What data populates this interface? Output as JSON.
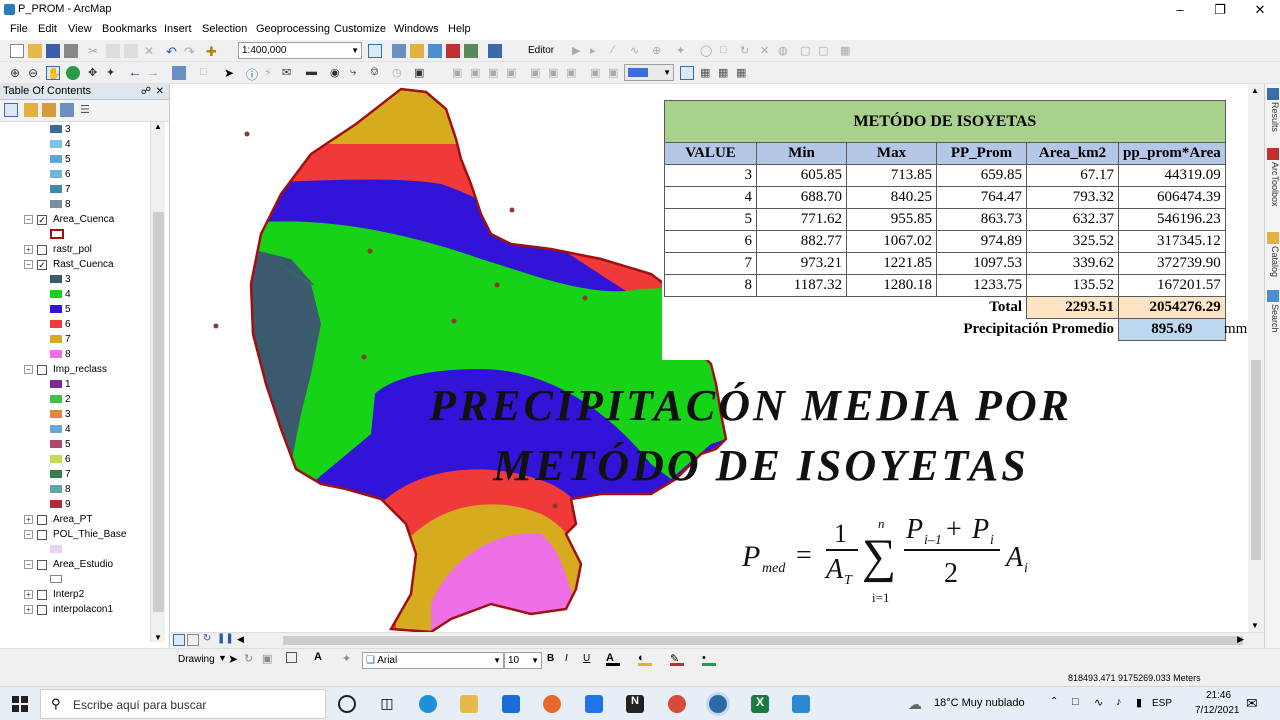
{
  "window": {
    "title": "P_PROM - ArcMap"
  },
  "menu": [
    "File",
    "Edit",
    "View",
    "Bookmarks",
    "Insert",
    "Selection",
    "Geoprocessing",
    "Customize",
    "Windows",
    "Help"
  ],
  "toolbar": {
    "scale_value": "1:400,000",
    "editor_label": "Editor"
  },
  "toc": {
    "title": "Table Of Contents",
    "rows": [
      {
        "type": "swatch",
        "label": "3",
        "color": "#3a6e9a"
      },
      {
        "type": "swatch",
        "label": "4",
        "color": "#7ec3e6"
      },
      {
        "type": "swatch",
        "label": "5",
        "color": "#5aa7d8"
      },
      {
        "type": "swatch",
        "label": "6",
        "color": "#6fb6d9"
      },
      {
        "type": "swatch",
        "label": "7",
        "color": "#3f8aa8"
      },
      {
        "type": "swatch",
        "label": "8",
        "color": "#7a8f9e"
      },
      {
        "type": "layer",
        "label": "Area_Cuenca",
        "checked": "✓"
      },
      {
        "type": "outline",
        "label": "",
        "color": "#a01010"
      },
      {
        "type": "layer",
        "label": "rastr_pol",
        "checked": ""
      },
      {
        "type": "layer",
        "label": "Rast_Cuenca",
        "checked": "✓"
      },
      {
        "type": "swatch",
        "label": "3",
        "color": "#3c5a6e"
      },
      {
        "type": "swatch",
        "label": "4",
        "color": "#17d317"
      },
      {
        "type": "swatch",
        "label": "5",
        "color": "#3214d8"
      },
      {
        "type": "swatch",
        "label": "6",
        "color": "#f03a3a"
      },
      {
        "type": "swatch",
        "label": "7",
        "color": "#d6ab1e"
      },
      {
        "type": "swatch",
        "label": "8",
        "color": "#ef70e6"
      },
      {
        "type": "layer",
        "label": "Imp_reclass",
        "checked": ""
      },
      {
        "type": "swatch",
        "label": "1",
        "color": "#7a2c8a"
      },
      {
        "type": "swatch",
        "label": "2",
        "color": "#44c04a"
      },
      {
        "type": "swatch",
        "label": "3",
        "color": "#e0893a"
      },
      {
        "type": "swatch",
        "label": "4",
        "color": "#6aa3d8"
      },
      {
        "type": "swatch",
        "label": "5",
        "color": "#b04a6a"
      },
      {
        "type": "swatch",
        "label": "6",
        "color": "#c8d850"
      },
      {
        "type": "swatch",
        "label": "7",
        "color": "#3a7a4a"
      },
      {
        "type": "swatch",
        "label": "8",
        "color": "#5aaaa0"
      },
      {
        "type": "swatch",
        "label": "9",
        "color": "#b02a3a"
      },
      {
        "type": "layer",
        "label": "Area_PT",
        "checked": ""
      },
      {
        "type": "layer",
        "label": "POL_Thie_Base",
        "checked": ""
      },
      {
        "type": "swatch",
        "label": "",
        "color": "#e8d4f0"
      },
      {
        "type": "layer",
        "label": "Area_Estudio",
        "checked": ""
      },
      {
        "type": "swatch",
        "label": "",
        "color": "#ffffff"
      },
      {
        "type": "layer",
        "label": "Interp2",
        "checked": ""
      },
      {
        "type": "layer",
        "label": "interpolacon1",
        "checked": ""
      }
    ]
  },
  "table": {
    "title": "METÓDO DE ISOYETAS",
    "headers": [
      "VALUE",
      "Min",
      "Max",
      "PP_Prom",
      "Area_km2",
      "pp_prom*Area"
    ],
    "rows": [
      [
        "3",
        "605.85",
        "713.85",
        "659.85",
        "67.17",
        "44319.09"
      ],
      [
        "4",
        "688.70",
        "840.25",
        "764.47",
        "793.32",
        "606474.39"
      ],
      [
        "5",
        "771.62",
        "955.85",
        "863.73",
        "632.37",
        "546196.23"
      ],
      [
        "6",
        "882.77",
        "1067.02",
        "974.89",
        "325.52",
        "317345.12"
      ],
      [
        "7",
        "973.21",
        "1221.85",
        "1097.53",
        "339.62",
        "372739.90"
      ],
      [
        "8",
        "1187.32",
        "1280.18",
        "1233.75",
        "135.52",
        "167201.57"
      ]
    ],
    "total_label": "Total",
    "total_area": "2293.51",
    "total_product": "2054276.29",
    "promedio_label": "Precipitación Promedio",
    "promedio_value": "895.69",
    "unit": "mm"
  },
  "overlay": {
    "line1": "PRECIPITACÓN MEDIA POR",
    "line2": "METÓDO DE ISOYETAS"
  },
  "right_tabs": [
    "Results",
    "ArcToolbox",
    "Catalog",
    "Search"
  ],
  "drawing": {
    "label": "Drawing",
    "font": "Arial",
    "size": "10"
  },
  "status": {
    "coords": "818493.471  9175269.033 Meters"
  },
  "taskbar": {
    "search_placeholder": "Escribe aquí para buscar",
    "weather": "18°C  Muy nublado",
    "lang": "ESP",
    "time": "21:46",
    "date": "7/12/2021"
  }
}
